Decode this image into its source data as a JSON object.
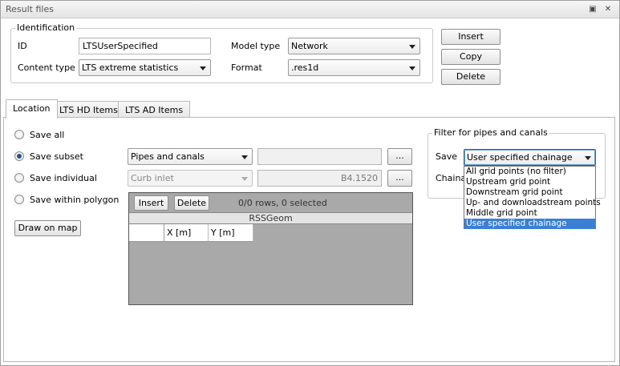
{
  "window": {
    "title": "Result files"
  },
  "identification": {
    "legend": "Identification",
    "id_label": "ID",
    "id_value": "LTSUserSpecified",
    "content_type_label": "Content type",
    "content_type_value": "LTS extreme statistics",
    "model_type_label": "Model type",
    "model_type_value": "Network",
    "format_label": "Format",
    "format_value": ".res1d"
  },
  "actions": {
    "insert": "Insert",
    "copy": "Copy",
    "delete": "Delete"
  },
  "tabs": [
    {
      "label": "Location"
    },
    {
      "label": "LTS HD Items"
    },
    {
      "label": "LTS AD Items"
    }
  ],
  "location": {
    "options": [
      {
        "label": "Save all"
      },
      {
        "label": "Save subset"
      },
      {
        "label": "Save individual"
      },
      {
        "label": "Save within polygon"
      }
    ],
    "selected_option": "Save subset",
    "subset_combo": "Pipes and canals",
    "individual_combo": "Curb inlet",
    "individual_value": "B4.1520",
    "browse_label": "...",
    "draw_on_map": "Draw on map",
    "grid": {
      "insert": "Insert",
      "delete": "Delete",
      "status": "0/0 rows, 0 selected",
      "caption": "RSSGeom",
      "columns": [
        "X [m]",
        "Y [m]"
      ]
    }
  },
  "filter": {
    "legend": "Filter for pipes and canals",
    "save_label": "Save",
    "chainage_label": "Chainage",
    "save_value": "User specified chainage",
    "options": [
      "All grid points (no filter)",
      "Upstream grid point",
      "Downstream grid point",
      "Up- and downloadstream points",
      "Middle grid point",
      "User specified chainage"
    ],
    "selected_index": 5
  },
  "icons": {
    "restore": "restore-icon",
    "close": "close-icon"
  }
}
